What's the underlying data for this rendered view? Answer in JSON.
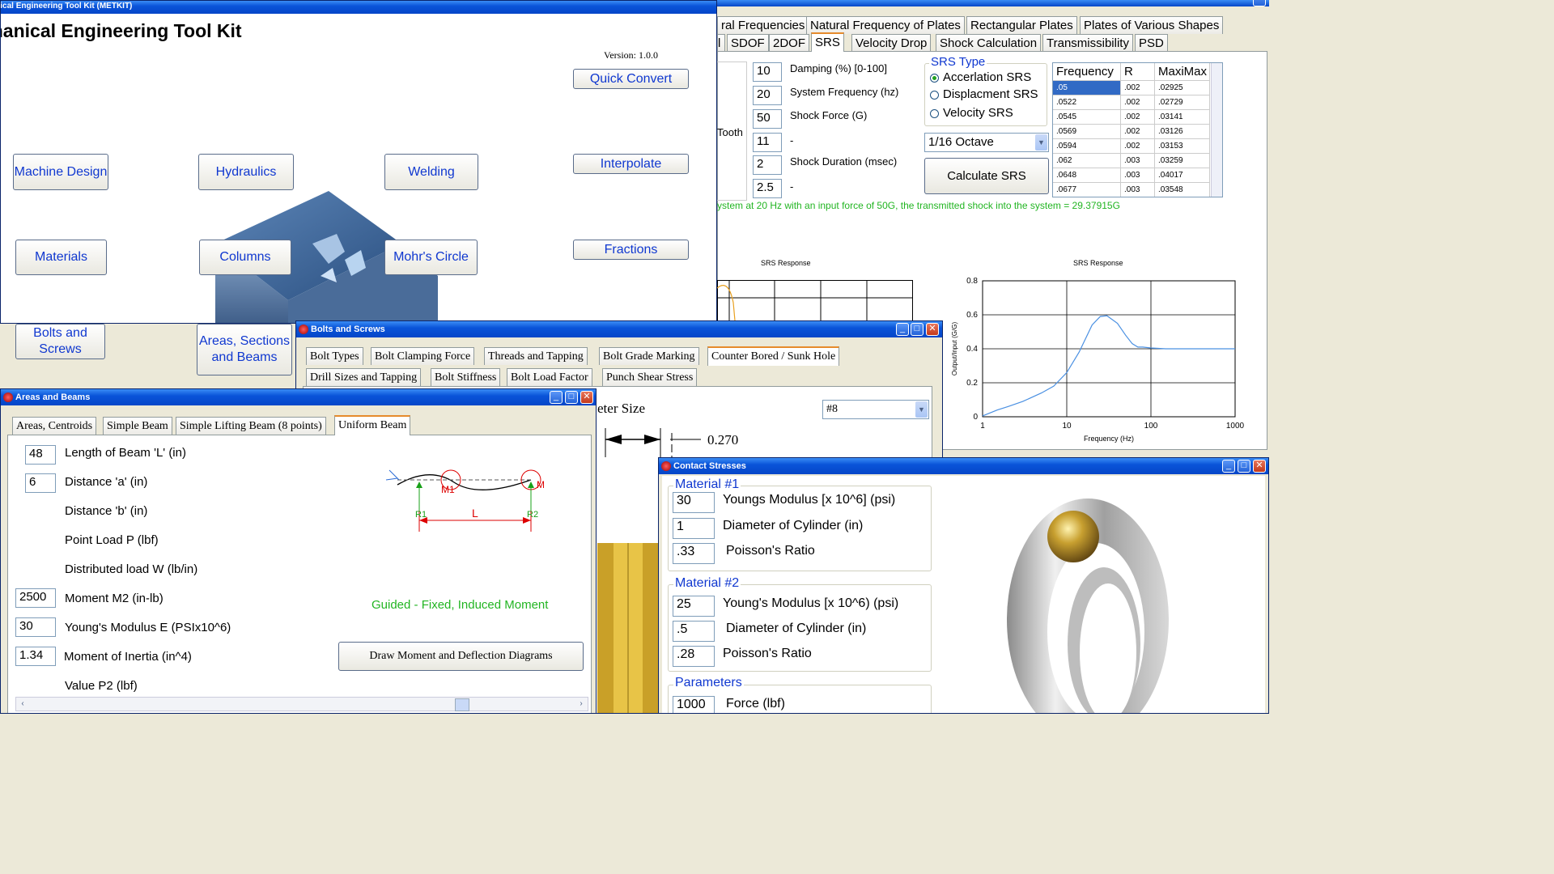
{
  "main": {
    "title": "Mechanical Engineering Tool Kit (METKIT)",
    "heading": "Mechanical Engineering Tool Kit",
    "version": "Version: 1.0.0",
    "buttons": {
      "quick_convert": "Quick Convert",
      "machine_design": "Machine Design",
      "hydraulics": "Hydraulics",
      "welding": "Welding",
      "interpolate": "Interpolate",
      "materials": "Materials",
      "columns": "Columns",
      "mohrs_circle": "Mohr's Circle",
      "fractions": "Fractions",
      "bolts_and_screws": "Bolts and Screws",
      "areas_sections_beams": "Areas, Sections and Beams"
    }
  },
  "vibration": {
    "tabs_row1": [
      "ral Frequencies",
      "Natural Frequency of Plates",
      "Rectangular Plates",
      "Plates of Various Shapes"
    ],
    "tabs_row2": [
      "l",
      "SDOF",
      "2DOF",
      "SRS",
      "Velocity Drop",
      "Shock Calculation",
      "Transmissibility",
      "PSD"
    ],
    "fields": [
      {
        "value": "10",
        "label": "Damping (%) [0-100]"
      },
      {
        "value": "20",
        "label": "System Frequency (hz)"
      },
      {
        "value": "50",
        "label": "Shock Force (G)"
      },
      {
        "value": "11",
        "label": "-"
      },
      {
        "value": "2",
        "label": "Shock Duration (msec)"
      },
      {
        "value": "2.5",
        "label": "-"
      }
    ],
    "tooth_label": "Tooth",
    "srs_type_title": "SRS Type",
    "srs_options": [
      "Accerlation SRS",
      "Displacment SRS",
      "Velocity SRS"
    ],
    "octave": "1/16 Octave",
    "calculate_label": "Calculate SRS",
    "grid_headers": [
      "Frequency",
      "R",
      "MaxiMax"
    ],
    "grid_rows": [
      [
        ".05",
        ".002",
        ".02925"
      ],
      [
        ".0522",
        ".002",
        ".02729"
      ],
      [
        ".0545",
        ".002",
        ".03141"
      ],
      [
        ".0569",
        ".002",
        ".03126"
      ],
      [
        ".0594",
        ".002",
        ".03153"
      ],
      [
        ".062",
        ".003",
        ".03259"
      ],
      [
        ".0648",
        ".003",
        ".04017"
      ],
      [
        ".0677",
        ".003",
        ".03548"
      ]
    ],
    "result_text": "ystem at  20 Hz with an input force of  50G, the transmitted shock into the system =  29.37915G",
    "chart_left_title": "SRS Response",
    "chart_right_title": "SRS Response"
  },
  "chart_data": {
    "type": "line",
    "title": "SRS Response",
    "xlabel": "Frequency (Hz)",
    "ylabel": "Output/Input (G/G)",
    "xscale": "log",
    "xlim": [
      1,
      1000
    ],
    "ylim": [
      0,
      0.8
    ],
    "xticks": [
      "1",
      "10",
      "100",
      "1000"
    ],
    "yticks": [
      "0",
      "0.2",
      "0.4",
      "0.6",
      "0.8"
    ],
    "grid": true,
    "color": "#4a90e2",
    "x": [
      1,
      1.5,
      2,
      3,
      5,
      7,
      10,
      14,
      20,
      25,
      30,
      40,
      50,
      60,
      70,
      80,
      100,
      150,
      200,
      300,
      500,
      1000
    ],
    "y": [
      0.005,
      0.04,
      0.06,
      0.09,
      0.14,
      0.18,
      0.26,
      0.38,
      0.54,
      0.59,
      0.595,
      0.55,
      0.48,
      0.43,
      0.41,
      0.41,
      0.405,
      0.4,
      0.4,
      0.4,
      0.4,
      0.4
    ]
  },
  "bolts": {
    "title": "Bolts and Screws",
    "tabs_row1": [
      "Bolt Types",
      "Bolt Clamping Force",
      "Threads and Tapping",
      "Bolt Grade Marking",
      "Counter Bored / Sunk Hole"
    ],
    "tabs_row2": [
      "Drill Sizes and Tapping",
      "Bolt Stiffness",
      "Bolt Load Factor",
      "Punch Shear Stress"
    ],
    "size_label": "eter Size",
    "size_value": "#8",
    "dimension": "0.270"
  },
  "areas": {
    "title": "Areas and Beams",
    "tabs": [
      "Areas, Centroids",
      "Simple Beam",
      "Simple Lifting Beam (8 points)",
      "Uniform Beam"
    ],
    "fields": [
      {
        "value": "48",
        "label": "Length of Beam 'L' (in)"
      },
      {
        "value": "6",
        "label": "Distance  'a'  (in)"
      },
      {
        "value": "",
        "label": "Distance  'b'  (in)"
      },
      {
        "value": "",
        "label": "Point Load P (lbf)"
      },
      {
        "value": "",
        "label": "Distributed load W (lb/in)"
      },
      {
        "value": "2500",
        "label": "Moment M2 (in-lb)"
      },
      {
        "value": "30",
        "label": "Young's Modulus  E (PSIx10^6)"
      },
      {
        "value": "1.34",
        "label": "Moment of Inertia (in^4)"
      },
      {
        "value": "",
        "label": "Value P2 (lbf)"
      }
    ],
    "case_label": "Guided - Fixed, Induced Moment",
    "draw_button": "Draw Moment and Deflection Diagrams",
    "diagram": {
      "r1": "R1",
      "r2": "R2",
      "m1": "M1",
      "m": "M",
      "l": "L"
    }
  },
  "contact": {
    "title": "Contact Stresses",
    "material1_title": "Material #1",
    "material1": [
      {
        "value": "30",
        "label": "Youngs Modulus [x 10^6] (psi)"
      },
      {
        "value": "1",
        "label": "Diameter of Cylinder (in)"
      },
      {
        "value": ".33",
        "label": "Poisson's Ratio"
      }
    ],
    "material2_title": "Material #2",
    "material2": [
      {
        "value": "25",
        "label": "Young's Modulus [x 10^6) (psi)"
      },
      {
        "value": ".5",
        "label": "Diameter of Cylinder (in)"
      },
      {
        "value": ".28",
        "label": "Poisson's Ratio"
      }
    ],
    "parameters_title": "Parameters",
    "parameters": [
      {
        "value": "1000",
        "label": "Force (lbf)"
      }
    ]
  }
}
